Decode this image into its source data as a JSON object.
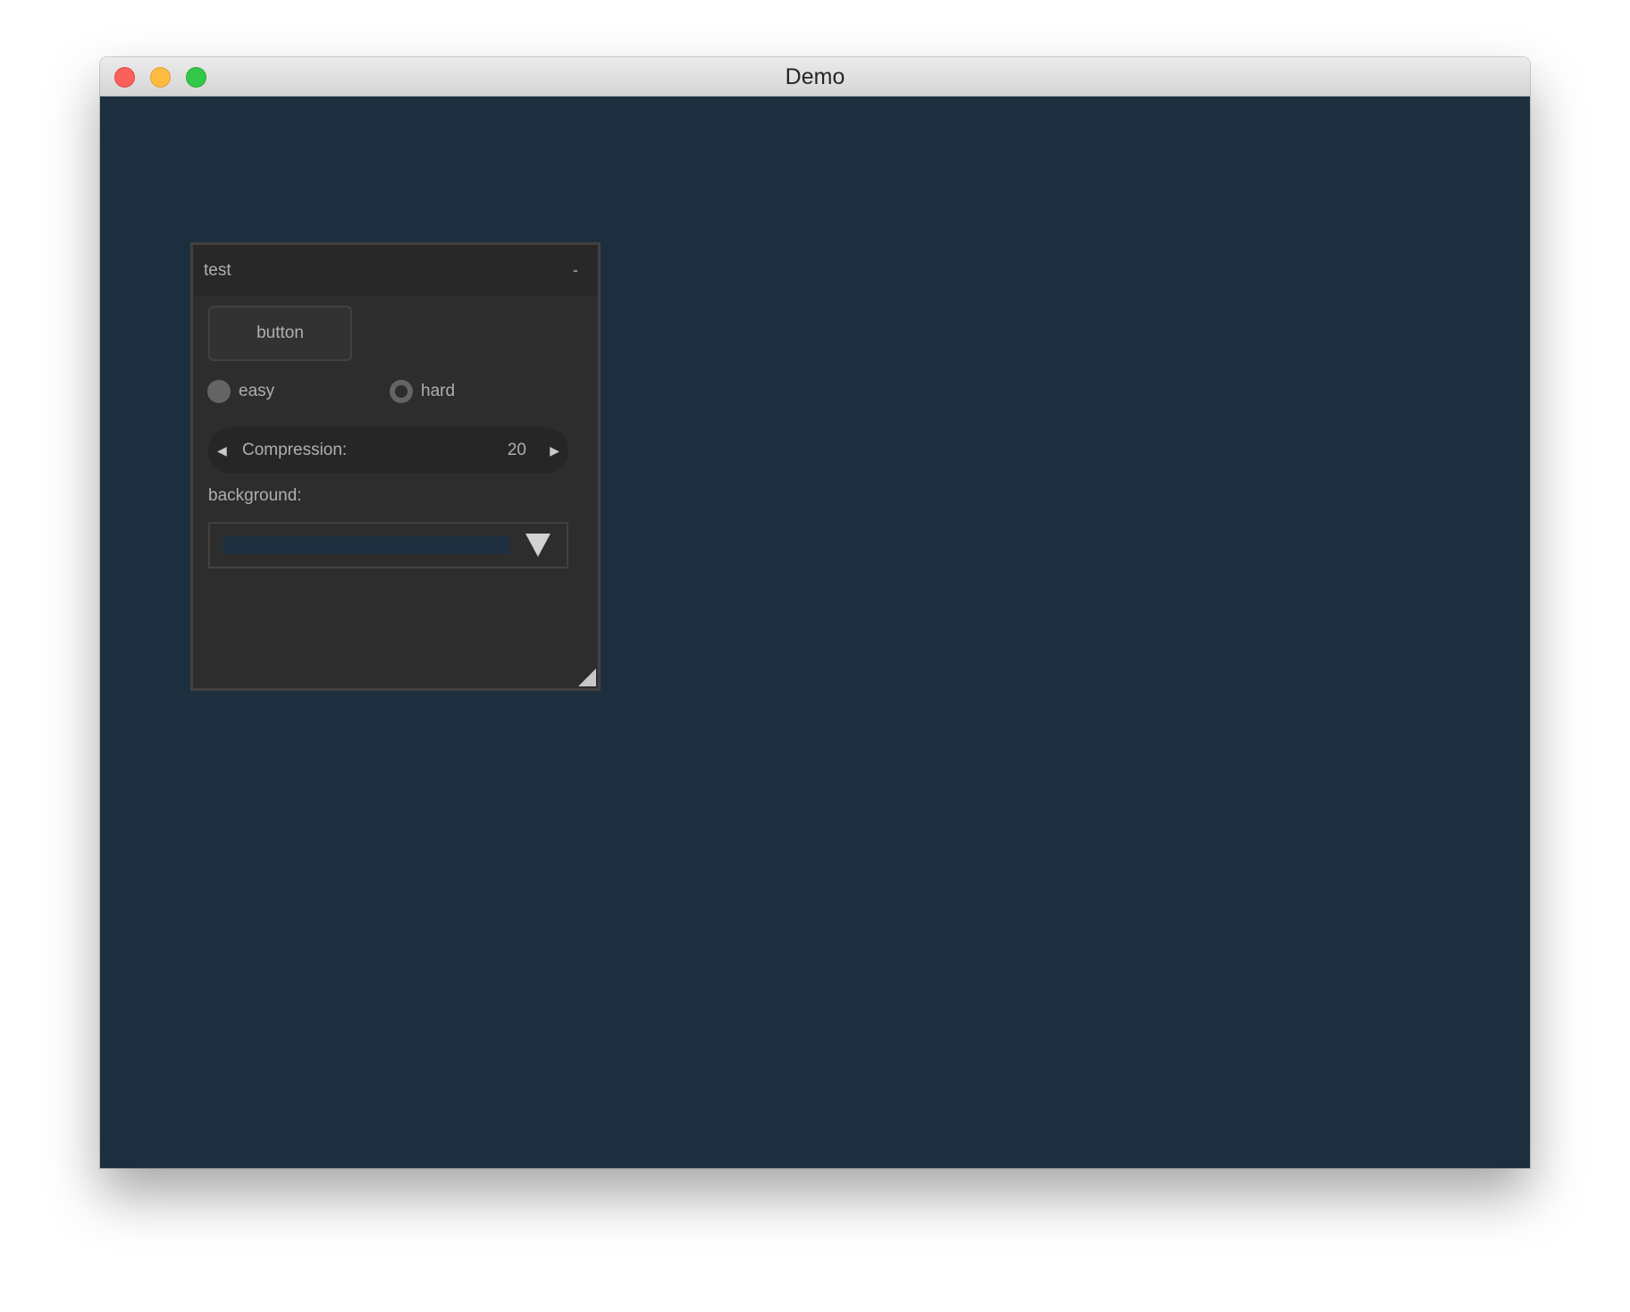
{
  "window": {
    "title": "Demo"
  },
  "app": {
    "background_color": "#1d2f3e"
  },
  "panel": {
    "title": "test",
    "minimize_label": "-",
    "button_label": "button",
    "difficulty": {
      "options": [
        "easy",
        "hard"
      ],
      "selected": "hard"
    },
    "compression": {
      "label": "Compression:",
      "value": "20",
      "decrement_icon": "triangle-left-icon",
      "increment_icon": "triangle-right-icon"
    },
    "background": {
      "label": "background:",
      "selected_color": "#1d2f3e",
      "dropdown_icon": "triangle-down-icon"
    }
  }
}
